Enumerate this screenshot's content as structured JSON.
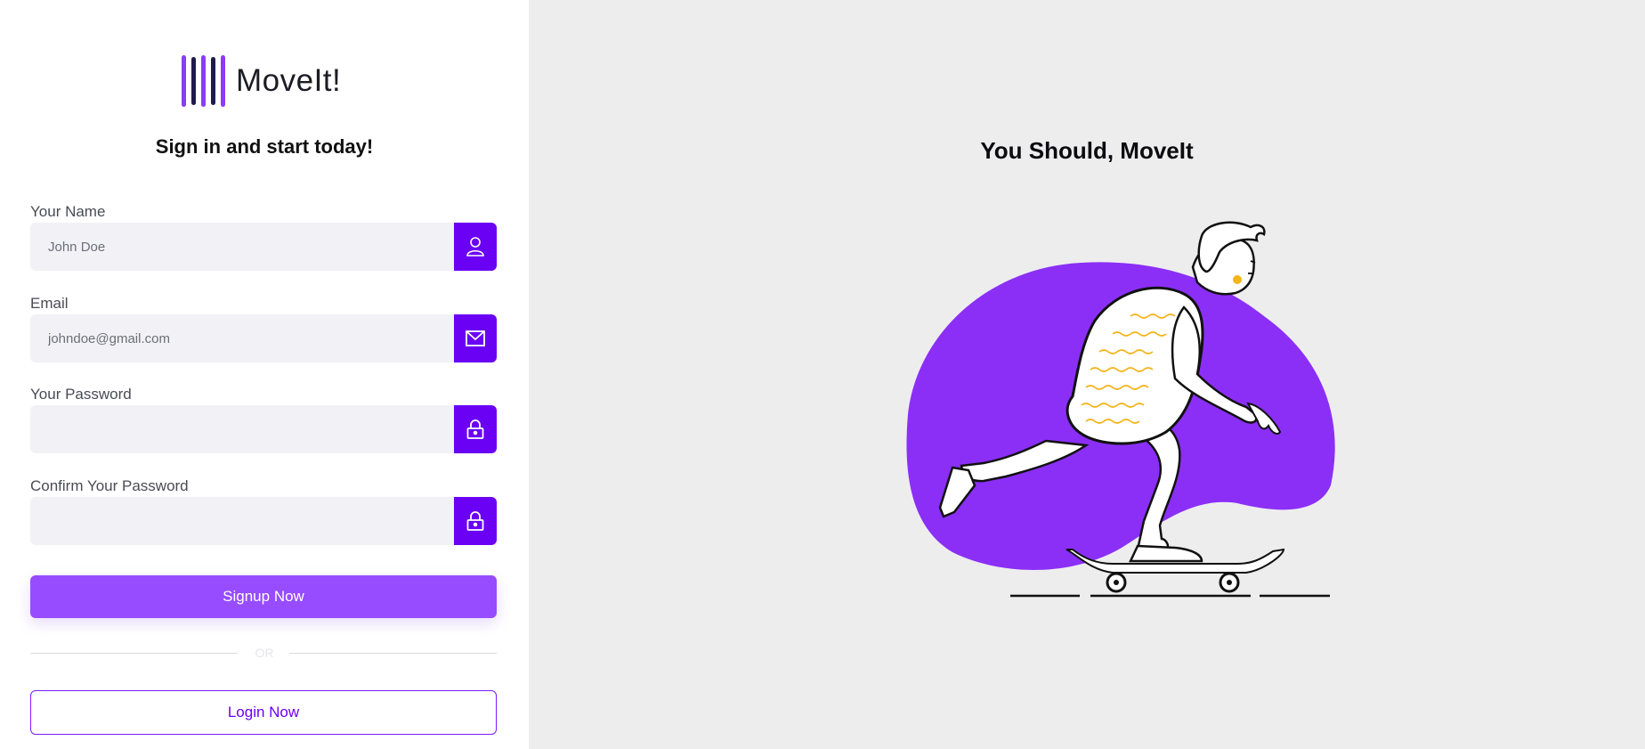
{
  "brand": {
    "name": "MoveIt!",
    "bar_colors": [
      "#8b3cf7",
      "#1e1b4b",
      "#8b3cf7",
      "#1e1b4b",
      "#8b3cf7"
    ]
  },
  "form": {
    "heading": "Sign in and start today!",
    "fields": [
      {
        "label": "Your Name",
        "placeholder": "John Doe",
        "icon": "user-icon"
      },
      {
        "label": "Email",
        "placeholder": "johndoe@gmail.com",
        "icon": "mail-icon"
      },
      {
        "label": "Your Password",
        "placeholder": "",
        "icon": "lock-icon"
      },
      {
        "label": "Confirm Your Password",
        "placeholder": "",
        "icon": "lock-icon"
      }
    ],
    "signup_label": "Signup Now",
    "or_text": "OR",
    "login_label": "Login Now"
  },
  "hero": {
    "title": "You Should, MoveIt",
    "illustration": "skateboarder-illustration"
  },
  "colors": {
    "accent": "#6a00f4",
    "button": "#974cff",
    "blob": "#8b2ff6",
    "field_bg": "#f1f1f6",
    "panel_bg": "#ededee"
  }
}
